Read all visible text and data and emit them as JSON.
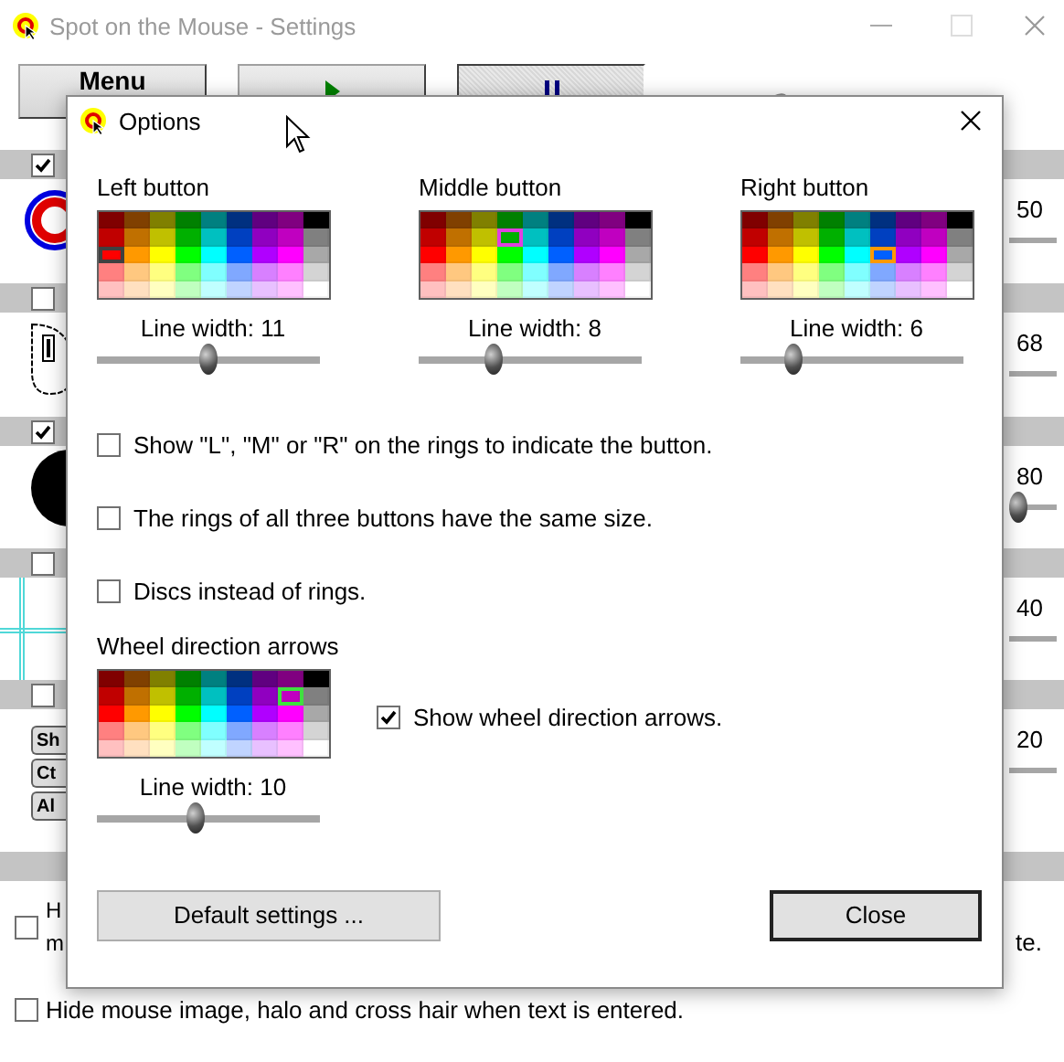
{
  "palette": [
    {
      "color": "#800000"
    },
    {
      "color": "#804000"
    },
    {
      "color": "#808000"
    },
    {
      "color": "#008000"
    },
    {
      "color": "#008080"
    },
    {
      "color": "#003080"
    },
    {
      "color": "#600080"
    },
    {
      "color": "#800080"
    },
    {
      "color": "#000000"
    },
    {
      "color": "#c00000"
    },
    {
      "color": "#c07000"
    },
    {
      "color": "#c0c000"
    },
    {
      "color": "#00b000"
    },
    {
      "color": "#00c0c0"
    },
    {
      "color": "#0040c0"
    },
    {
      "color": "#9000c0"
    },
    {
      "color": "#c000c0"
    },
    {
      "color": "#808080"
    },
    {
      "color": "#ff0000"
    },
    {
      "color": "#ff9900"
    },
    {
      "color": "#ffff00"
    },
    {
      "color": "#00ff00"
    },
    {
      "color": "#00ffff"
    },
    {
      "color": "#0060ff"
    },
    {
      "color": "#b000ff"
    },
    {
      "color": "#ff00ff"
    },
    {
      "color": "#a8a8a8"
    },
    {
      "color": "#ff8080"
    },
    {
      "color": "#ffc880"
    },
    {
      "color": "#ffff80"
    },
    {
      "color": "#80ff80"
    },
    {
      "color": "#80ffff"
    },
    {
      "color": "#80a8ff"
    },
    {
      "color": "#d880ff"
    },
    {
      "color": "#ff80ff"
    },
    {
      "color": "#d4d4d4"
    },
    {
      "color": "#ffc0c0"
    },
    {
      "color": "#ffe0c0"
    },
    {
      "color": "#ffffc0"
    },
    {
      "color": "#c0ffc0"
    },
    {
      "color": "#c0ffff"
    },
    {
      "color": "#c0d4ff"
    },
    {
      "color": "#e8c0ff"
    },
    {
      "color": "#ffc0ff"
    },
    {
      "color": "#ffffff"
    }
  ],
  "main_window": {
    "title": "Spot on the Mouse - Settings",
    "toolbar": [
      {
        "kind": "menu",
        "label": "Menu",
        "pressed": false
      },
      {
        "kind": "play",
        "pressed": false
      },
      {
        "kind": "pause",
        "pressed": true
      }
    ],
    "rows": [
      {
        "kind": "rings",
        "checked": true,
        "value": "50",
        "thumb_shown": false
      },
      {
        "kind": "mouse",
        "checked": false,
        "value": "68",
        "thumb_shown": false
      },
      {
        "kind": "disc",
        "checked": true,
        "value": "80",
        "thumb_shown": true
      },
      {
        "kind": "crosshair",
        "checked": false,
        "value": "40",
        "thumb_shown": false
      },
      {
        "kind": "keys",
        "checked": false,
        "value": "20",
        "thumb_shown": false,
        "keys": [
          "Sh",
          "Ct",
          "Al"
        ]
      }
    ],
    "options": [
      {
        "kind": "cut",
        "checked": false,
        "line_1": "H",
        "line_2": "m",
        "line_end": "te."
      },
      {
        "kind": "full",
        "checked": false,
        "text": "Hide mouse image, halo and cross hair when text is entered."
      }
    ]
  },
  "options_dialog": {
    "title": "Options",
    "pickers": [
      {
        "label": "Left button",
        "color": "#404040",
        "line_width": "Line width: 11",
        "level": 0.5,
        "cells": [
          {
            "selected": false
          },
          {
            "selected": false
          },
          {
            "selected": false
          },
          {
            "selected": false
          },
          {
            "selected": false
          },
          {
            "selected": false
          },
          {
            "selected": false
          },
          {
            "selected": false
          },
          {
            "selected": false
          },
          {
            "selected": false
          },
          {
            "selected": false
          },
          {
            "selected": false
          },
          {
            "selected": false
          },
          {
            "selected": false
          },
          {
            "selected": false
          },
          {
            "selected": false
          },
          {
            "selected": false
          },
          {
            "selected": false
          },
          {
            "selected": true
          },
          {
            "selected": false
          },
          {
            "selected": false
          },
          {
            "selected": false
          },
          {
            "selected": false
          },
          {
            "selected": false
          },
          {
            "selected": false
          },
          {
            "selected": false
          },
          {
            "selected": false
          },
          {
            "selected": false
          },
          {
            "selected": false
          },
          {
            "selected": false
          },
          {
            "selected": false
          },
          {
            "selected": false
          },
          {
            "selected": false
          },
          {
            "selected": false
          },
          {
            "selected": false
          },
          {
            "selected": false
          },
          {
            "selected": false
          },
          {
            "selected": false
          },
          {
            "selected": false
          },
          {
            "selected": false
          },
          {
            "selected": false
          },
          {
            "selected": false
          },
          {
            "selected": false
          },
          {
            "selected": false
          },
          {
            "selected": false
          }
        ]
      },
      {
        "label": "Middle button",
        "color": "#e040e0",
        "line_width": "Line width: 8",
        "level": 0.34,
        "cells": [
          {
            "selected": false
          },
          {
            "selected": false
          },
          {
            "selected": false
          },
          {
            "selected": false
          },
          {
            "selected": false
          },
          {
            "selected": false
          },
          {
            "selected": false
          },
          {
            "selected": false
          },
          {
            "selected": false
          },
          {
            "selected": false
          },
          {
            "selected": false
          },
          {
            "selected": false
          },
          {
            "selected": true
          },
          {
            "selected": false
          },
          {
            "selected": false
          },
          {
            "selected": false
          },
          {
            "selected": false
          },
          {
            "selected": false
          },
          {
            "selected": false
          },
          {
            "selected": false
          },
          {
            "selected": false
          },
          {
            "selected": false
          },
          {
            "selected": false
          },
          {
            "selected": false
          },
          {
            "selected": false
          },
          {
            "selected": false
          },
          {
            "selected": false
          },
          {
            "selected": false
          },
          {
            "selected": false
          },
          {
            "selected": false
          },
          {
            "selected": false
          },
          {
            "selected": false
          },
          {
            "selected": false
          },
          {
            "selected": false
          },
          {
            "selected": false
          },
          {
            "selected": false
          },
          {
            "selected": false
          },
          {
            "selected": false
          },
          {
            "selected": false
          },
          {
            "selected": false
          },
          {
            "selected": false
          },
          {
            "selected": false
          },
          {
            "selected": false
          },
          {
            "selected": false
          },
          {
            "selected": false
          }
        ]
      },
      {
        "label": "Right button",
        "color": "#ff9900",
        "line_width": "Line width: 6",
        "level": 0.24,
        "cells": [
          {
            "selected": false
          },
          {
            "selected": false
          },
          {
            "selected": false
          },
          {
            "selected": false
          },
          {
            "selected": false
          },
          {
            "selected": false
          },
          {
            "selected": false
          },
          {
            "selected": false
          },
          {
            "selected": false
          },
          {
            "selected": false
          },
          {
            "selected": false
          },
          {
            "selected": false
          },
          {
            "selected": false
          },
          {
            "selected": false
          },
          {
            "selected": false
          },
          {
            "selected": false
          },
          {
            "selected": false
          },
          {
            "selected": false
          },
          {
            "selected": false
          },
          {
            "selected": false
          },
          {
            "selected": false
          },
          {
            "selected": false
          },
          {
            "selected": false
          },
          {
            "selected": true
          },
          {
            "selected": false
          },
          {
            "selected": false
          },
          {
            "selected": false
          },
          {
            "selected": false
          },
          {
            "selected": false
          },
          {
            "selected": false
          },
          {
            "selected": false
          },
          {
            "selected": false
          },
          {
            "selected": false
          },
          {
            "selected": false
          },
          {
            "selected": false
          },
          {
            "selected": false
          },
          {
            "selected": false
          },
          {
            "selected": false
          },
          {
            "selected": false
          },
          {
            "selected": false
          },
          {
            "selected": false
          },
          {
            "selected": false
          },
          {
            "selected": false
          },
          {
            "selected": false
          },
          {
            "selected": false
          }
        ]
      }
    ],
    "checkboxes": [
      {
        "label": "Show \"L\", \"M\" or \"R\" on the rings to indicate the button.",
        "checked": false
      },
      {
        "label": "The rings of all three buttons have the same size.",
        "checked": false
      },
      {
        "label": "Discs instead of rings.",
        "checked": false
      }
    ],
    "wheel": {
      "label": "Wheel direction arrows",
      "color": "#40e040",
      "line_width": "Line width: 10",
      "level": 0.44,
      "cells": [
        {
          "selected": false
        },
        {
          "selected": false
        },
        {
          "selected": false
        },
        {
          "selected": false
        },
        {
          "selected": false
        },
        {
          "selected": false
        },
        {
          "selected": false
        },
        {
          "selected": false
        },
        {
          "selected": false
        },
        {
          "selected": false
        },
        {
          "selected": false
        },
        {
          "selected": false
        },
        {
          "selected": false
        },
        {
          "selected": false
        },
        {
          "selected": false
        },
        {
          "selected": false
        },
        {
          "selected": true
        },
        {
          "selected": false
        },
        {
          "selected": false
        },
        {
          "selected": false
        },
        {
          "selected": false
        },
        {
          "selected": false
        },
        {
          "selected": false
        },
        {
          "selected": false
        },
        {
          "selected": false
        },
        {
          "selected": false
        },
        {
          "selected": false
        },
        {
          "selected": false
        },
        {
          "selected": false
        },
        {
          "selected": false
        },
        {
          "selected": false
        },
        {
          "selected": false
        },
        {
          "selected": false
        },
        {
          "selected": false
        },
        {
          "selected": false
        },
        {
          "selected": false
        },
        {
          "selected": false
        },
        {
          "selected": false
        },
        {
          "selected": false
        },
        {
          "selected": false
        },
        {
          "selected": false
        },
        {
          "selected": false
        },
        {
          "selected": false
        },
        {
          "selected": false
        },
        {
          "selected": false
        }
      ],
      "show_arrows": {
        "label": "Show wheel direction arrows.",
        "checked": true
      }
    },
    "buttons": [
      {
        "label": "Default settings ...",
        "default": false
      },
      {
        "label": "Close",
        "default": true
      }
    ]
  }
}
